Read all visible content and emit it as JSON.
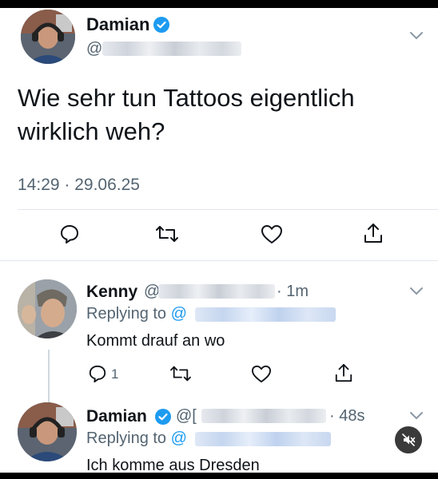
{
  "main_tweet": {
    "author_name": "Damian",
    "handle_prefix": "@",
    "text": "Wie sehr tun Tattoos eigentlich wirklich weh?",
    "timestamp": "14:29 · 29.06.25"
  },
  "reply_1": {
    "author_name": "Kenny",
    "handle_prefix": "@",
    "time": "· 1m",
    "replying_label": "Replying to",
    "replying_at": "@",
    "text": "Kommt drauf an wo",
    "reply_count": "1"
  },
  "reply_2": {
    "author_name": "Damian",
    "handle_prefix": "@[",
    "time": "· 48s",
    "replying_label": "Replying to",
    "replying_at": "@",
    "text": "Ich komme aus Dresden"
  },
  "colors": {
    "accent": "#1d9bf0",
    "secondary_text": "#536471",
    "primary_text": "#0f1419"
  },
  "icons": [
    "verified-badge-icon",
    "chevron-down-icon",
    "reply-icon",
    "retweet-icon",
    "like-icon",
    "share-icon",
    "speaker-muted-icon"
  ]
}
